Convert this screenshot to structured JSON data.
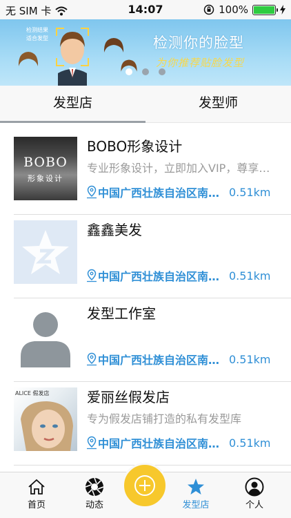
{
  "status_bar": {
    "carrier": "无 SIM 卡",
    "time": "14:07",
    "battery_percent": "100%",
    "battery_level": 1.0
  },
  "banner": {
    "small_text_1": "检测结果",
    "small_text_2": "适合发型",
    "title": "检测你的脸型",
    "subtitle": "为你推荐贴脸发型",
    "page_count": 3,
    "active_page": 1
  },
  "tabs": [
    {
      "label": "发型店",
      "active": true
    },
    {
      "label": "发型师",
      "active": false
    }
  ],
  "shops": [
    {
      "name": "BOBO形象设计",
      "desc": "专业形象设计，立即加入VIP，尊享折扣",
      "address": "中国广西壮族自治区南宁市",
      "distance": "0.51km",
      "thumb_text": "BOBO",
      "thumb_sub": "形象设计"
    },
    {
      "name": "鑫鑫美发",
      "desc": "",
      "address": "中国广西壮族自治区南宁市",
      "distance": "0.51km"
    },
    {
      "name": "发型工作室",
      "desc": "",
      "address": "中国广西壮族自治区南宁市",
      "distance": "0.51km"
    },
    {
      "name": "爱丽丝假发店",
      "desc": "专为假发店铺打造的私有发型库",
      "address": "中国广西壮族自治区南宁市",
      "distance": "0.51km",
      "thumb_text": "ALICE 假发店"
    }
  ],
  "bottom_nav": {
    "home": "首页",
    "moments": "动态",
    "shops": "发型店",
    "profile": "个人"
  },
  "colors": {
    "accent": "#2f8fd6",
    "fab": "#f7c82c",
    "banner": "#a8dcf6"
  },
  "icons": {
    "location": "location-pin-icon",
    "home": "home-icon",
    "moments": "aperture-icon",
    "shops": "star-icon",
    "profile": "person-icon",
    "fab": "plus-circle-icon"
  }
}
